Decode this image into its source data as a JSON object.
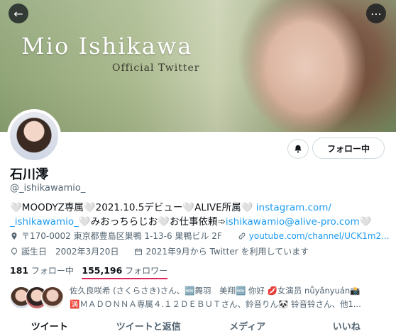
{
  "header": {
    "banner_title": "Mio Ishikawa",
    "banner_subtitle": "Official Twitter",
    "back_icon": "←",
    "more_icon": "⋯"
  },
  "profile": {
    "display_name": "石川澪",
    "handle": "@_ishikawamio_",
    "follow_button": "フォロー中",
    "notify_icon": "🔔"
  },
  "bio": {
    "line1_text": "🤍MOODYZ専属🤍2021.10.5デビュー🤍ALIVE所属🤍",
    "line1_link": "instagram.com/",
    "line2_link": "_ishikawamio_",
    "line2_text": "🤍みおっちらじお🤍お仕事依頼➾",
    "line2_email": "ishikawamio@alive-pro.com",
    "line2_end": "🤍"
  },
  "meta": {
    "location": "〒170-0002 東京都豊島区巣鴨 1-13-6 巣鴨ビル 2F",
    "website": "youtube.com/channel/UCK1m2...",
    "birthday": "誕生日　2002年3月20日",
    "joined": "2021年9月から Twitter を利用しています"
  },
  "counts": {
    "following_num": "181",
    "following_label": "フォロー中",
    "followers_num": "155,196",
    "followers_label": "フォロワー"
  },
  "followed_by": {
    "line1": "佐久良咲希 (さくらさき)さん、🆕舞羽　美翔🆕 你好 💋女演员 nǚyǎnyuán📸",
    "line2": "🈵ＭＡＤＯＮＮＡ専属４.１２ＤＥＢＵＴさん、鈴音りん🐼 铃音铃さん、他1..."
  },
  "tabs": [
    "ツイート",
    "ツイートと返信",
    "メディア",
    "いいね"
  ],
  "colors": {
    "link": "#1d9bf0",
    "underline": "#e0245e",
    "muted": "#536471"
  }
}
